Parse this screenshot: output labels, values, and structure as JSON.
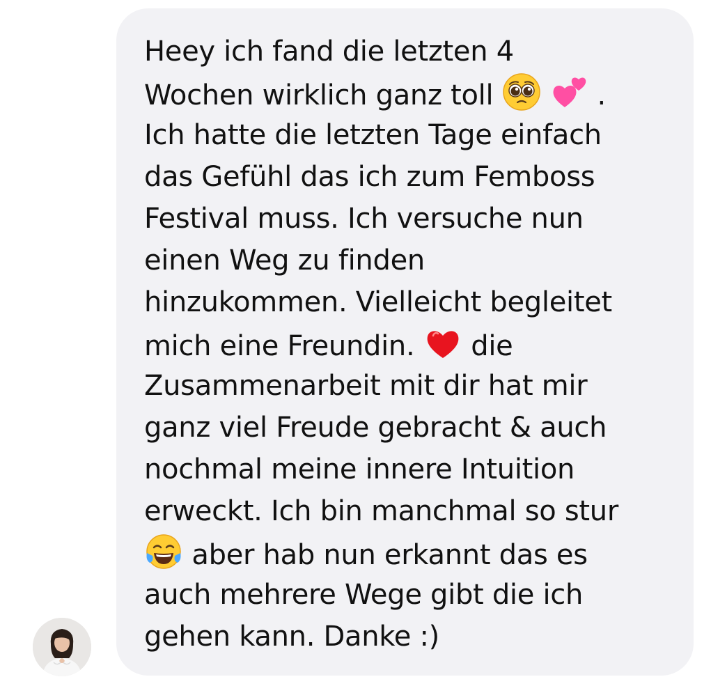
{
  "message": {
    "lines": {
      "l1": "Heey ich fand die letzten 4",
      "l2a": "Wochen wirklich ganz toll",
      "l2b": ".",
      "l3": "Ich hatte die letzten Tage einfach",
      "l4": "das Gefühl das ich zum Femboss",
      "l5": "Festival muss. Ich versuche nun",
      "l6": "einen Weg zu finden",
      "l7": "hinzukommen. Vielleicht begleitet",
      "l8a": "mich eine Freundin.",
      "l8b": "die",
      "l9": "Zusammenarbeit mit dir hat mir",
      "l10": "ganz viel Freude gebracht & auch",
      "l11": "nochmal meine innere Intuition",
      "l12": "erweckt. Ich bin manchmal so stur",
      "l13": "aber hab nun erkannt das es",
      "l14": "auch mehrere Wege gibt die ich",
      "l15": "gehen kann. Danke :)"
    },
    "emojis": {
      "pleading": "pleading-face-emoji",
      "two_hearts": "two-hearts-emoji",
      "red_heart": "red-heart-emoji",
      "tears_of_joy": "face-with-tears-of-joy-emoji"
    }
  },
  "sender": {
    "avatar_icon": "profile-photo-avatar"
  },
  "colors": {
    "bubble_background": "#f2f2f5",
    "text": "#111111"
  }
}
